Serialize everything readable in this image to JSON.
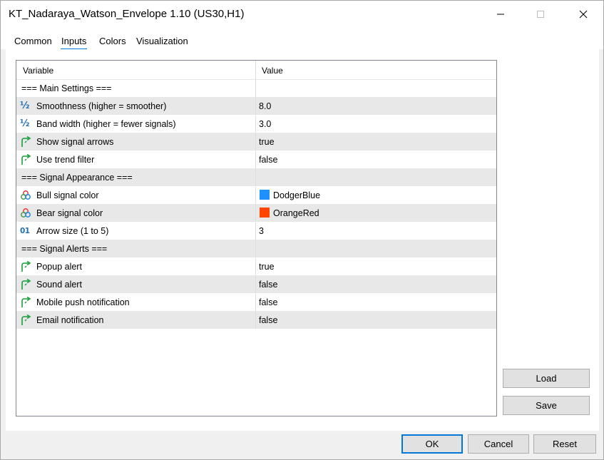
{
  "window": {
    "title": "KT_Nadaraya_Watson_Envelope 1.10 (US30,H1)"
  },
  "tabs": [
    {
      "label": "Common"
    },
    {
      "label": "Inputs"
    },
    {
      "label": "Colors"
    },
    {
      "label": "Visualization"
    }
  ],
  "active_tab": "Inputs",
  "table": {
    "headers": {
      "variable": "Variable",
      "value": "Value"
    },
    "rows": [
      {
        "name": "=== Main Settings ===",
        "value": "",
        "kind": "section"
      },
      {
        "name": "Smoothness (higher = smoother)",
        "value": "8.0",
        "icon": "half-icon"
      },
      {
        "name": "Band width (higher = fewer signals)",
        "value": "3.0",
        "icon": "half-icon"
      },
      {
        "name": "Show signal arrows",
        "value": "true",
        "icon": "bool-arrow-icon"
      },
      {
        "name": "Use trend filter",
        "value": "false",
        "icon": "bool-arrow-icon"
      },
      {
        "name": "=== Signal Appearance ===",
        "value": "",
        "kind": "section"
      },
      {
        "name": "Bull signal color",
        "value": "DodgerBlue",
        "icon": "color-palette-icon",
        "swatch": "#1e90ff"
      },
      {
        "name": "Bear signal color",
        "value": "OrangeRed",
        "icon": "color-palette-icon",
        "swatch": "#ff4500"
      },
      {
        "name": "Arrow size (1 to 5)",
        "value": "3",
        "icon": "integer-icon"
      },
      {
        "name": "=== Signal Alerts ===",
        "value": "",
        "kind": "section"
      },
      {
        "name": "Popup alert",
        "value": "true",
        "icon": "bool-arrow-icon"
      },
      {
        "name": "Sound alert",
        "value": "false",
        "icon": "bool-arrow-icon"
      },
      {
        "name": "Mobile push notification",
        "value": "false",
        "icon": "bool-arrow-icon"
      },
      {
        "name": "Email notification",
        "value": "false",
        "icon": "bool-arrow-icon"
      }
    ]
  },
  "side_buttons": {
    "load": "Load",
    "save": "Save"
  },
  "footer_buttons": {
    "ok": "OK",
    "cancel": "Cancel",
    "reset": "Reset"
  },
  "icons": {
    "half": "½",
    "integer": "01"
  },
  "colors": {
    "accent": "#0078d7",
    "bool_icon": "#1a9e3a",
    "number_icon": "#1f6fb3"
  }
}
